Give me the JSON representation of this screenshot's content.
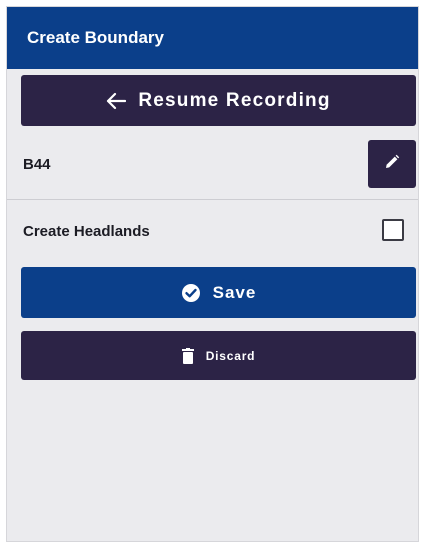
{
  "header": {
    "title": "Create Boundary"
  },
  "resume": {
    "label": "Resume Recording",
    "icon": "arrow-left-icon"
  },
  "boundary": {
    "name": "B44",
    "edit_icon": "pencil-icon"
  },
  "headlands": {
    "label": "Create Headlands",
    "checked": false
  },
  "save": {
    "label": "Save",
    "icon": "check-circle-icon"
  },
  "discard": {
    "label": "Discard",
    "icon": "trash-icon"
  },
  "colors": {
    "header": "#0b3f8a",
    "primary_button": "#0b3f8a",
    "dark_button": "#2c2346",
    "panel_background": "#ebebee"
  }
}
